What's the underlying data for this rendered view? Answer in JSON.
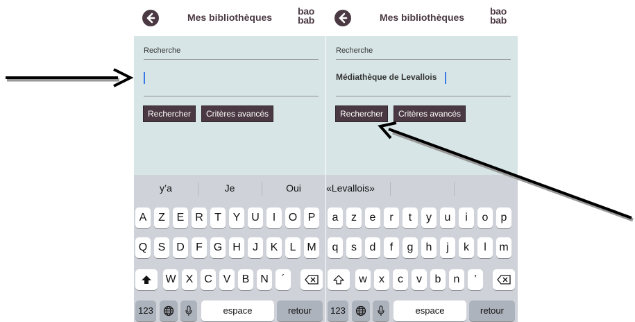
{
  "left_screen": {
    "header": {
      "title": "Mes bibliothèques",
      "logo_top": "bao",
      "logo_bottom": "bab"
    },
    "search": {
      "label": "Recherche",
      "value": ""
    },
    "buttons": {
      "search": "Rechercher",
      "advanced": "Critères avancés"
    },
    "keyboard": {
      "suggestions": [
        "y’a",
        "Je",
        "Oui"
      ],
      "row1": [
        "A",
        "Z",
        "E",
        "R",
        "T",
        "Y",
        "U",
        "I",
        "O",
        "P"
      ],
      "row2": [
        "Q",
        "S",
        "D",
        "F",
        "G",
        "H",
        "J",
        "K",
        "L",
        "M"
      ],
      "row3": [
        "W",
        "X",
        "C",
        "V",
        "B",
        "N",
        "´"
      ],
      "numbers": "123",
      "space": "espace",
      "return": "retour"
    }
  },
  "right_screen": {
    "header": {
      "title": "Mes bibliothèques",
      "logo_top": "bao",
      "logo_bottom": "bab"
    },
    "search": {
      "label": "Recherche",
      "value": "Médiathèque de Levallois"
    },
    "buttons": {
      "search": "Rechercher",
      "advanced": "Critères avancés"
    },
    "keyboard": {
      "suggestions": [
        "«Levallois»",
        "",
        ""
      ],
      "row1": [
        "a",
        "z",
        "e",
        "r",
        "t",
        "y",
        "u",
        "i",
        "o",
        "p"
      ],
      "row2": [
        "q",
        "s",
        "d",
        "f",
        "g",
        "h",
        "j",
        "k",
        "l",
        "m"
      ],
      "row3": [
        "w",
        "x",
        "c",
        "v",
        "b",
        "n",
        "’"
      ],
      "numbers": "123",
      "space": "espace",
      "return": "retour"
    }
  },
  "icons": {
    "back": "back-arrow-icon",
    "shift": "shift-icon",
    "delete": "backspace-icon",
    "globe": "globe-icon",
    "mic": "microphone-icon"
  },
  "colors": {
    "brand": "#4a3942",
    "content_bg": "#d8e5e6",
    "keyboard_bg": "#cfd3d9",
    "caret": "#3a78e6"
  }
}
